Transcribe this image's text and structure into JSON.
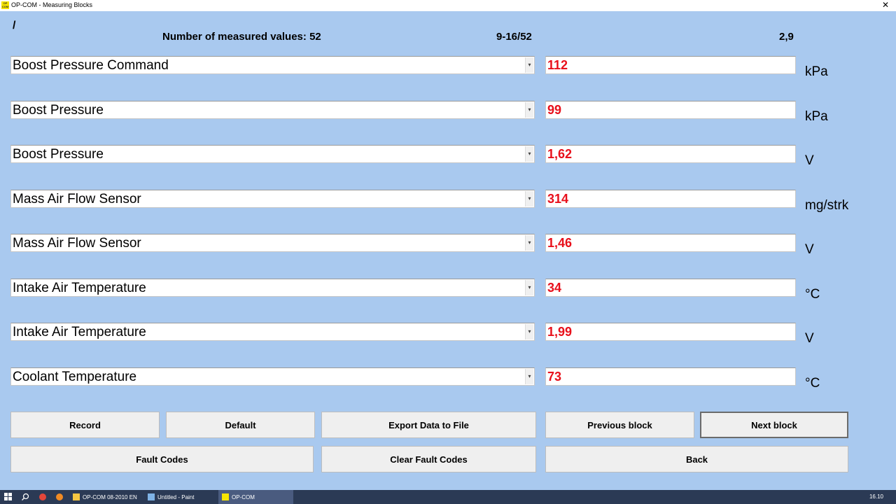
{
  "window": {
    "title": "OP-COM - Measuring Blocks",
    "icon_text": "OP COM",
    "close_icon": "close-icon"
  },
  "header": {
    "slash": "/",
    "measured_count": "Number of measured values: 52",
    "range": "9-16/52",
    "ratio": "2,9"
  },
  "rows": [
    {
      "label": "Boost Pressure Command",
      "value": "112",
      "unit": "kPa"
    },
    {
      "label": "Boost Pressure",
      "value": "99",
      "unit": "kPa"
    },
    {
      "label": "Boost Pressure",
      "value": "1,62",
      "unit": "V"
    },
    {
      "label": "Mass Air Flow Sensor",
      "value": "314",
      "unit": "mg/strk"
    },
    {
      "label": "Mass Air Flow Sensor",
      "value": "1,46",
      "unit": "V"
    },
    {
      "label": "Intake Air Temperature",
      "value": "34",
      "unit": "°C"
    },
    {
      "label": "Intake Air Temperature",
      "value": "1,99",
      "unit": "V"
    },
    {
      "label": "Coolant Temperature",
      "value": "73",
      "unit": "°C"
    }
  ],
  "buttons": {
    "record": "Record",
    "default": "Default",
    "export": "Export Data to File",
    "previous": "Previous block",
    "next": "Next block",
    "fault_codes": "Fault Codes",
    "clear_fault_codes": "Clear Fault Codes",
    "back": "Back"
  },
  "taskbar": {
    "items": [
      "OP-COM 08-2010 EN",
      "Untitled - Paint",
      "OP-COM"
    ],
    "clock": "16.10"
  },
  "colors": {
    "background": "#a9c9ef",
    "value_text": "#e8101b",
    "taskbar": "#2b3a55"
  }
}
